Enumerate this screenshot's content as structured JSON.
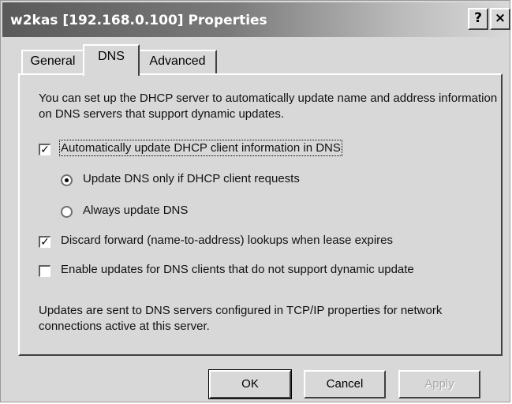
{
  "window": {
    "title": "w2kas [192.168.0.100] Properties",
    "help_glyph": "?",
    "close_glyph": "×"
  },
  "tabs": [
    {
      "label": "General",
      "selected": false
    },
    {
      "label": "DNS",
      "selected": true
    },
    {
      "label": "Advanced",
      "selected": false
    }
  ],
  "dns": {
    "intro": "You can set up the DHCP server to automatically update name and address information on DNS servers that support dynamic updates.",
    "auto_update": {
      "label": "Automatically update DHCP client information in DNS",
      "checked": true
    },
    "radio_request": {
      "label": "Update DNS only if DHCP client requests",
      "selected": true
    },
    "radio_always": {
      "label": "Always update DNS",
      "selected": false
    },
    "discard_forward": {
      "label": "Discard forward (name-to-address) lookups when lease expires",
      "checked": true
    },
    "enable_updates": {
      "label": "Enable updates for DNS clients that do not support dynamic update",
      "checked": false
    },
    "footer": "Updates are sent to DNS servers configured in TCP/IP properties for network connections active at this server."
  },
  "buttons": {
    "ok": "OK",
    "cancel": "Cancel",
    "apply": "Apply"
  },
  "colors": {
    "titlebar_start": "#5a5a5a",
    "face": "#d8d8d8",
    "disabled_text": "#a8a8a8"
  }
}
